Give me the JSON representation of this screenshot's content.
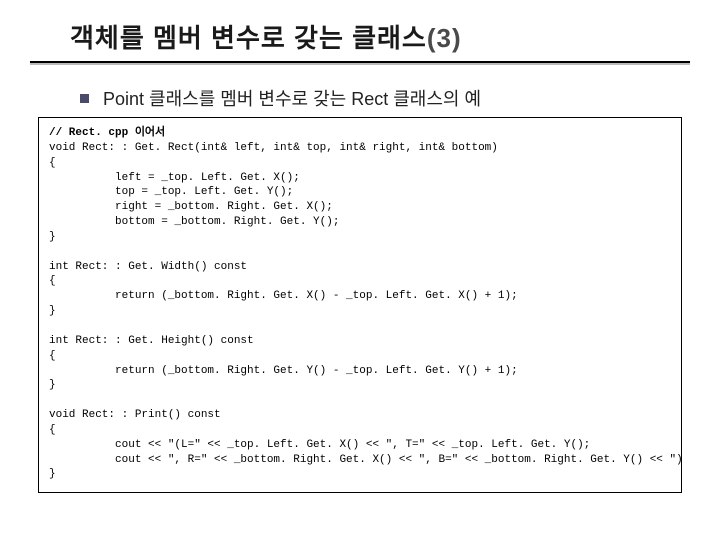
{
  "title": {
    "main": "객체를 멤버 변수로 갖는 클래스",
    "suffix": "(3)"
  },
  "subtitle": "Point 클래스를 멤버 변수로 갖는 Rect 클래스의 예",
  "code": {
    "l01": "// Rect. cpp 이어서",
    "l02": "void Rect: : Get. Rect(int& left, int& top, int& right, int& bottom)",
    "l03": "{",
    "l04": "          left = _top. Left. Get. X();",
    "l05": "          top = _top. Left. Get. Y();",
    "l06": "          right = _bottom. Right. Get. X();",
    "l07": "          bottom = _bottom. Right. Get. Y();",
    "l08": "}",
    "l09": "",
    "l10": "int Rect: : Get. Width() const",
    "l11": "{",
    "l12": "          return (_bottom. Right. Get. X() - _top. Left. Get. X() + 1);",
    "l13": "}",
    "l14": "",
    "l15": "int Rect: : Get. Height() const",
    "l16": "{",
    "l17": "          return (_bottom. Right. Get. Y() - _top. Left. Get. Y() + 1);",
    "l18": "}",
    "l19": "",
    "l20": "void Rect: : Print() const",
    "l21": "{",
    "l22": "          cout << \"(L=\" << _top. Left. Get. X() << \", T=\" << _top. Left. Get. Y();",
    "l23": "          cout << \", R=\" << _bottom. Right. Get. X() << \", B=\" << _bottom. Right. Get. Y() << \")\\n\";",
    "l24": "}"
  }
}
